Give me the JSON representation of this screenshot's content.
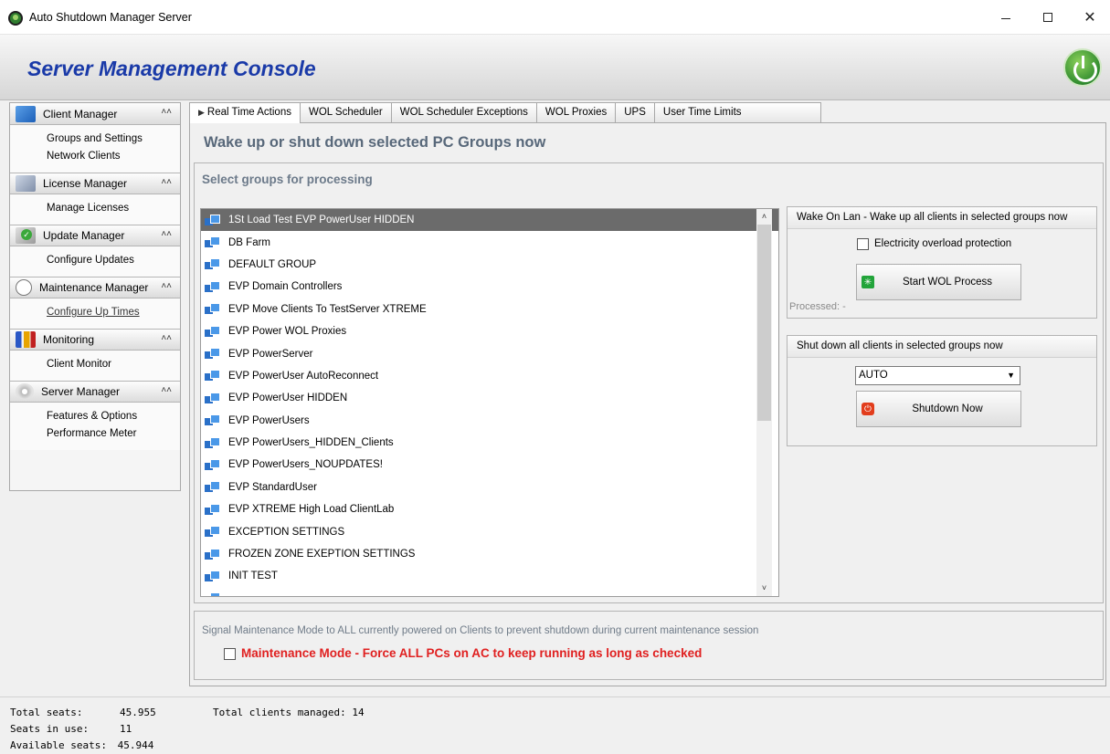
{
  "window": {
    "title": "Auto Shutdown Manager Server",
    "minimize": "—",
    "maximize": "☐",
    "close": "✕"
  },
  "banner": {
    "title": "Server Management Console"
  },
  "sidebar": {
    "groups": [
      {
        "label": "Client Manager",
        "icon": "client-manager-icon",
        "items": [
          "Groups and Settings",
          "Network Clients"
        ]
      },
      {
        "label": "License Manager",
        "icon": "license-manager-icon",
        "items": [
          "Manage Licenses"
        ]
      },
      {
        "label": "Update Manager",
        "icon": "update-manager-icon",
        "items": [
          "Configure Updates"
        ]
      },
      {
        "label": "Maintenance Manager",
        "icon": "clock-icon",
        "items": [
          "Configure Up Times"
        ]
      },
      {
        "label": "Monitoring",
        "icon": "monitoring-icon",
        "items": [
          "Client Monitor"
        ]
      },
      {
        "label": "Server Manager",
        "icon": "gear-icon",
        "items": [
          "Features & Options",
          "Performance Meter"
        ]
      }
    ],
    "collapse_glyph": "≈"
  },
  "stats": {
    "total_seats_label": "Total seats:",
    "total_seats": "45.955",
    "seats_in_use_label": "Seats in use:",
    "seats_in_use": "11",
    "available_label": "Available seats:",
    "available": "45.944",
    "total_managed": "Total clients managed: 14"
  },
  "tabs": [
    "Real Time Actions",
    "WOL Scheduler",
    "WOL Scheduler Exceptions",
    "WOL Proxies",
    "UPS",
    "User Time Limits"
  ],
  "main": {
    "heading": "Wake up or shut down selected  PC Groups now",
    "groups_title": "Select groups for processing",
    "groups": [
      "1St Load Test EVP PowerUser HIDDEN",
      "DB Farm",
      "DEFAULT GROUP",
      "EVP Domain Controllers",
      "EVP Move Clients To TestServer XTREME",
      "EVP Power WOL Proxies",
      "EVP PowerServer",
      "EVP PowerUser AutoReconnect",
      "EVP PowerUser HIDDEN",
      "EVP PowerUsers",
      "EVP PowerUsers_HIDDEN_Clients",
      "EVP PowerUsers_NOUPDATES!",
      "EVP StandardUser",
      "EVP XTREME High Load ClientLab",
      "EXCEPTION SETTINGS",
      "FROZEN ZONE EXEPTION SETTINGS",
      "INIT TEST",
      ""
    ],
    "selected_index": 0
  },
  "wol": {
    "title": "Wake On Lan - Wake up  all clients in selected groups now",
    "electricity_label": "Electricity overload protection",
    "button_label": "Start WOL Process",
    "processed": "Processed:  -"
  },
  "shutdown": {
    "title": "Shut down all clients in selected groups now",
    "mode_value": "AUTO",
    "button_label": "Shutdown Now"
  },
  "maintenance": {
    "caption": "Signal Maintenance Mode to ALL currently powered on Clients to prevent shutdown during current maintenance session",
    "checkbox_label": "Maintenance Mode - Force  ALL  PCs on AC to keep running as long as checked"
  },
  "colors": {
    "heading": "#58687a",
    "console_title": "#1a3aa8",
    "maintenance_label": "#e02020",
    "selected_row": "#6b6b6b"
  }
}
